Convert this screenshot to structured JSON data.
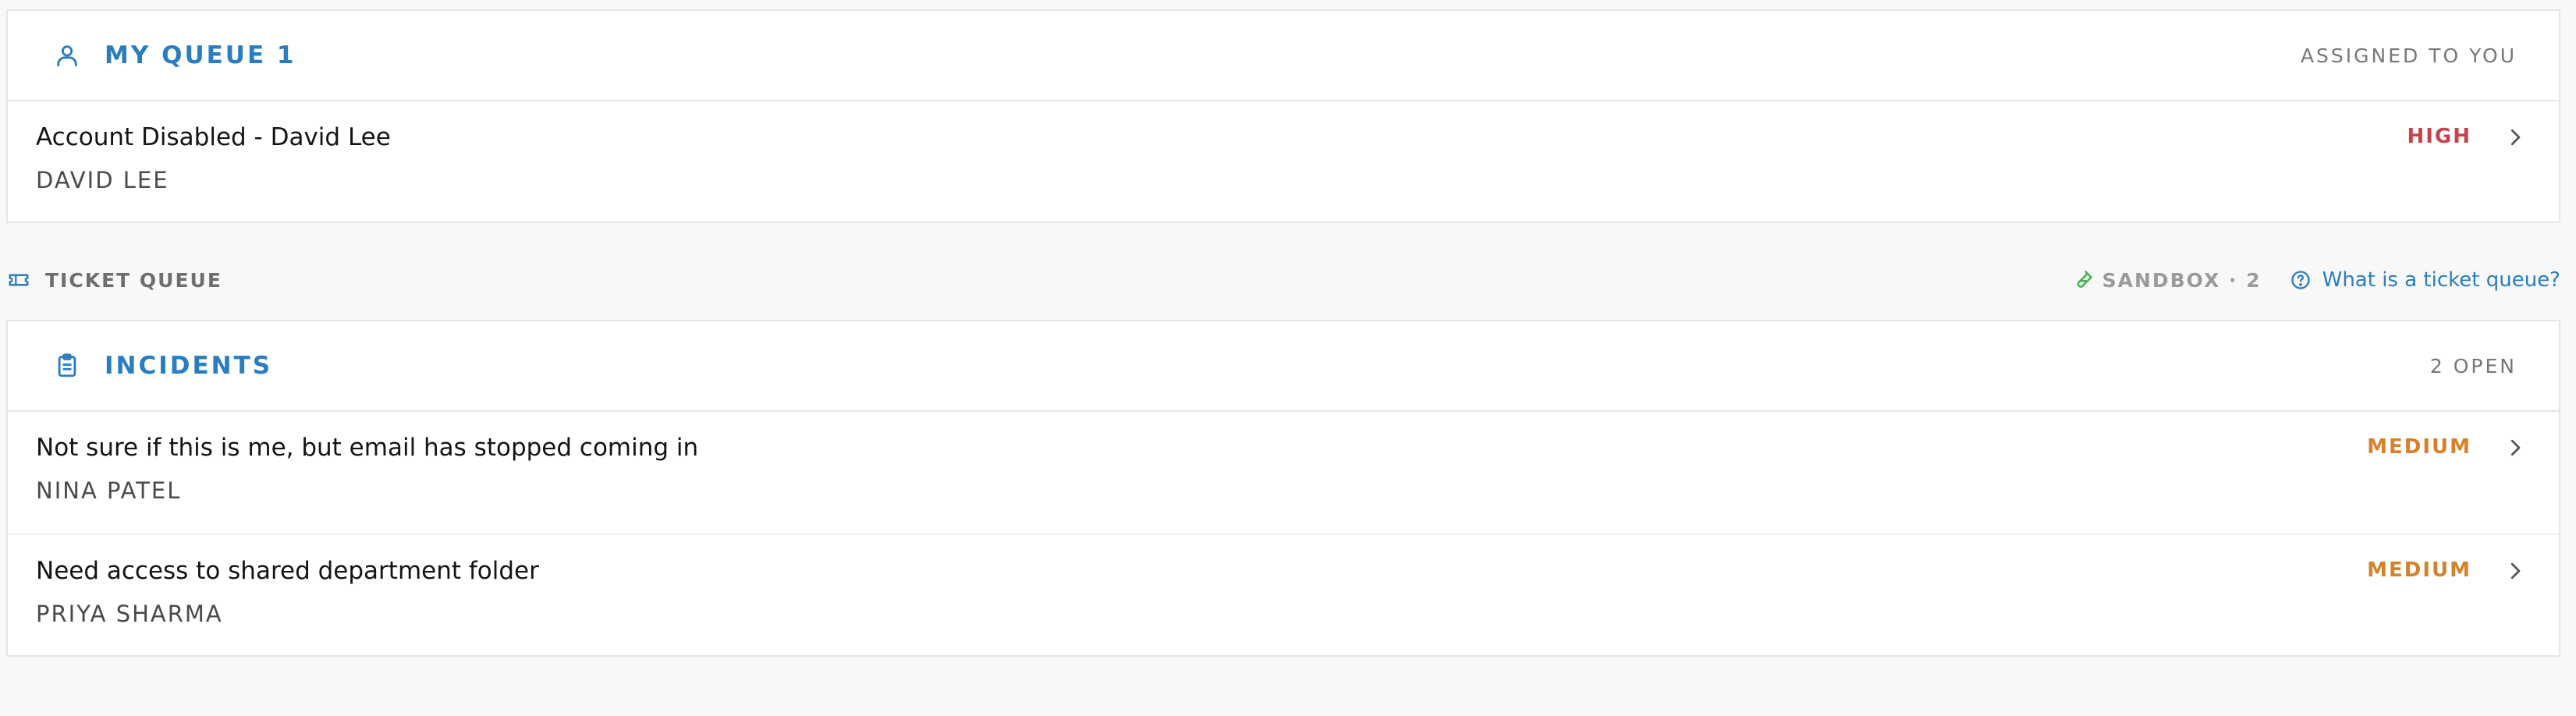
{
  "my_queue": {
    "icon": "user-icon",
    "title": "MY QUEUE 1",
    "right_label": "ASSIGNED TO YOU",
    "tickets": [
      {
        "title": "Account Disabled - David Lee",
        "requester": "DAVID LEE",
        "priority": "HIGH",
        "priority_color": "#c8424b"
      }
    ]
  },
  "ticket_queue_bar": {
    "icon": "ticket-icon",
    "label": "TICKET QUEUE",
    "sandbox_icon": "test-tube-icon",
    "sandbox_label": "SANDBOX · 2",
    "help_icon": "help-circle-icon",
    "help_label": "What is a ticket queue?"
  },
  "incidents": {
    "icon": "clipboard-icon",
    "title": "INCIDENTS",
    "right_label": "2 OPEN",
    "tickets": [
      {
        "title": "Not sure if this is me, but email has stopped coming in",
        "requester": "NINA PATEL",
        "priority": "MEDIUM",
        "priority_color": "#d6822b"
      },
      {
        "title": "Need access to shared department folder",
        "requester": "PRIYA SHARMA",
        "priority": "MEDIUM",
        "priority_color": "#d6822b"
      }
    ]
  },
  "colors": {
    "accent": "#2a7dc1",
    "high": "#c8424b",
    "medium": "#d6822b",
    "sandbox_icon": "#4caf50"
  }
}
